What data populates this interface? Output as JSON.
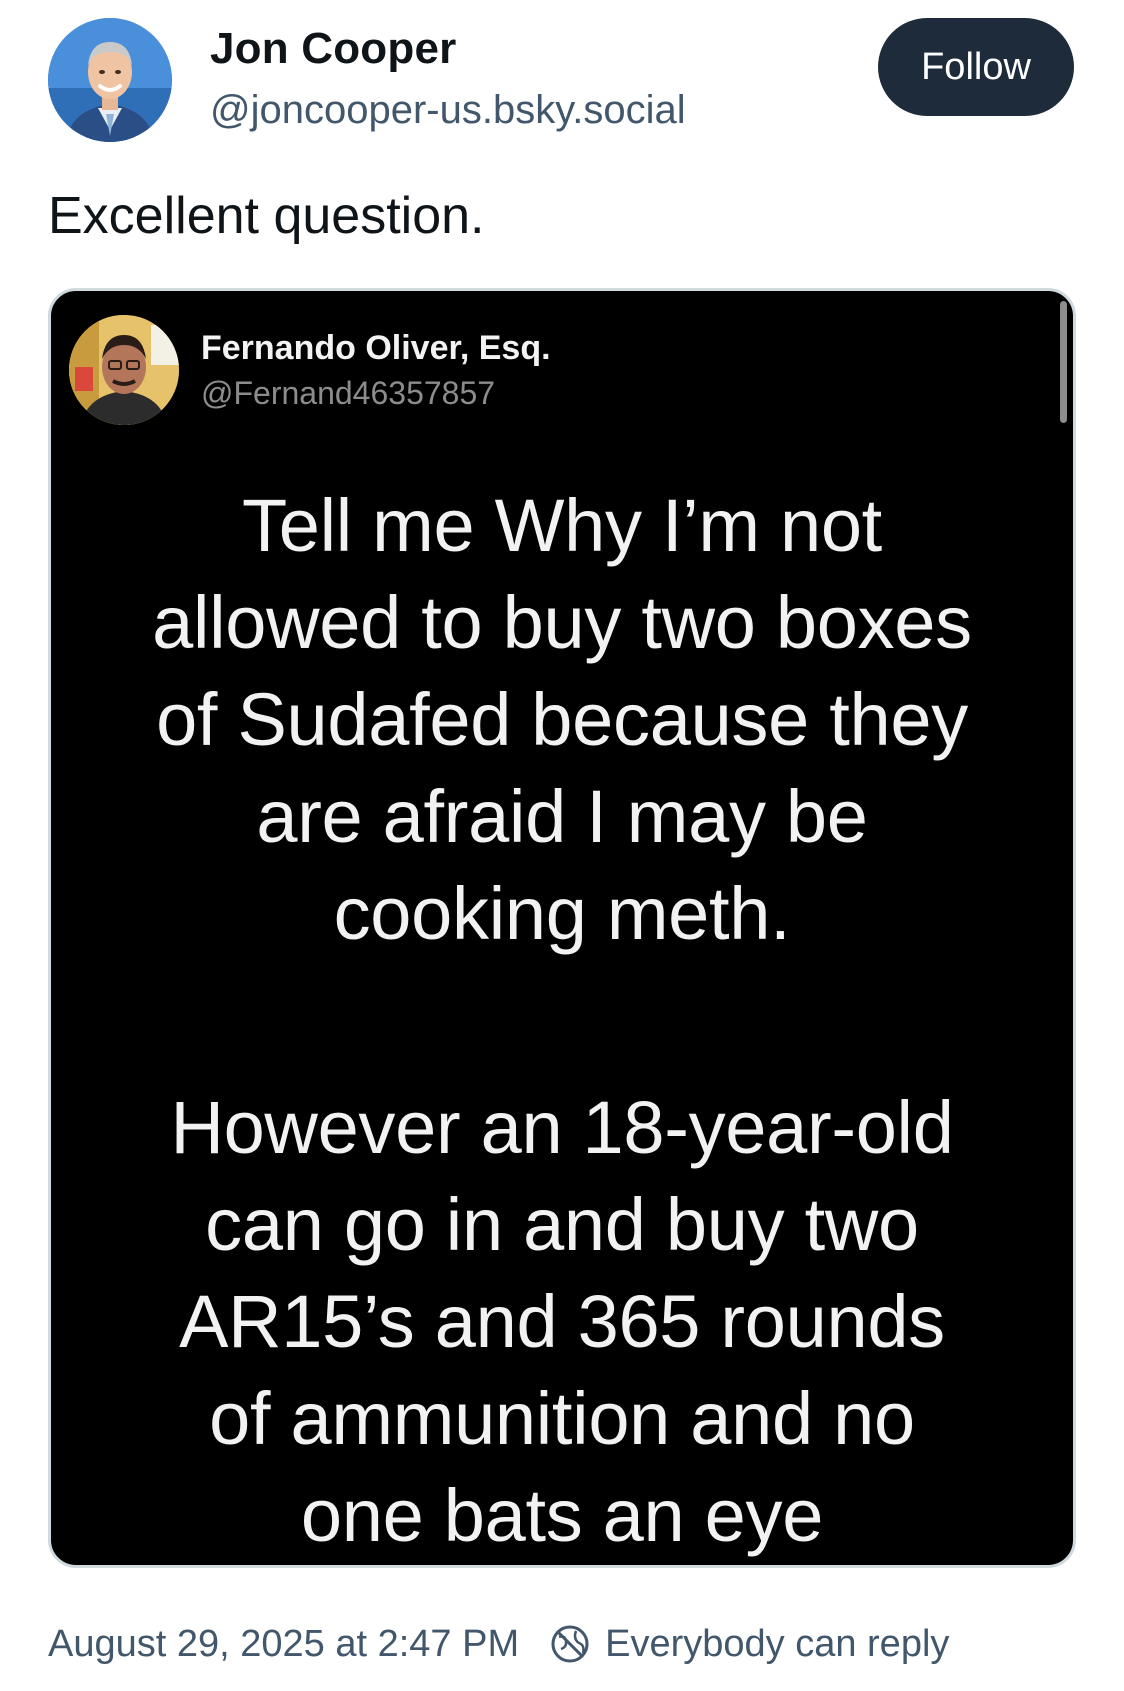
{
  "post": {
    "author": {
      "name": "Jon Cooper",
      "handle": "@joncooper-us.bsky.social"
    },
    "follow_label": "Follow",
    "text": "Excellent question.",
    "timestamp": "August 29, 2025 at 2:47 PM",
    "reply_setting": "Everybody can reply"
  },
  "embed": {
    "author": {
      "name": "Fernando Oliver, Esq.",
      "handle": "@Fernand46357857"
    },
    "paragraphs": [
      {
        "lines": [
          "Tell me Why I’m not",
          "allowed to buy two boxes",
          "of Sudafed because they",
          "are afraid I may be",
          "cooking meth."
        ]
      },
      {
        "lines": [
          "However an 18-year-old",
          "can go in and buy two",
          "AR15’s and 365 rounds",
          "of ammunition and no",
          "one bats an eye"
        ]
      }
    ]
  },
  "colors": {
    "follow_button_bg": "#1e2b3a",
    "handle_text": "#42576c",
    "embed_bg": "#000000",
    "embed_text": "#f2f2f2"
  },
  "icons": {
    "reply_setting": "globe-crossed-icon"
  }
}
